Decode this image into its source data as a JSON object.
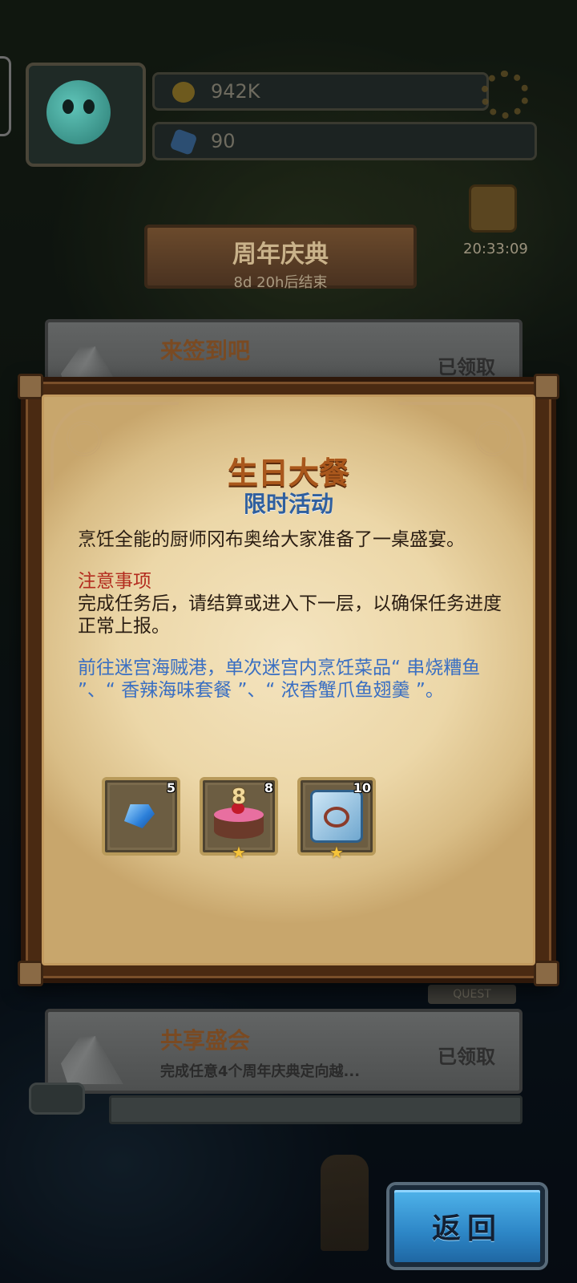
{
  "background": {
    "resources": {
      "gold": "942K",
      "gems": "90"
    },
    "event_banner": {
      "title": "周年庆典",
      "subtitle": "8d 20h后结束"
    },
    "timer": "20:33:09",
    "quests": [
      {
        "title": "来签到吧",
        "status": "已领取"
      },
      {
        "title": "共享盛会",
        "description": "完成任意4个周年庆典定向越...",
        "status": "已领取"
      }
    ],
    "quest_tag": "QUEST"
  },
  "dialog": {
    "title": "生日大餐",
    "subtitle": "限时活动",
    "intro": "烹饪全能的厨师冈布奥给大家准备了一桌盛宴。",
    "note_heading": "注意事项",
    "note_body": "完成任务后，请结算或进入下一层，以确保任务进度正常上报。",
    "task_text": "前往迷宫海贼港，单次迷宫内烹饪菜品“ 串烧糟鱼 ”、“ 香辣海味套餐 ”、“ 浓香蟹爪鱼翅羹 ”。",
    "rewards": [
      {
        "icon": "blue-gem-icon",
        "count": "5",
        "star": ""
      },
      {
        "icon": "birthday-cake-icon",
        "count": "8",
        "candle": "8",
        "star": "★"
      },
      {
        "icon": "puzzle-piece-icon",
        "count": "10",
        "star": "★"
      }
    ]
  },
  "return_button": "返回",
  "colors": {
    "title": "#a9571c",
    "subtitle": "#2f5f9e",
    "note": "#b32b1e",
    "task": "#3a6fc2",
    "button": "#2d86c6"
  }
}
